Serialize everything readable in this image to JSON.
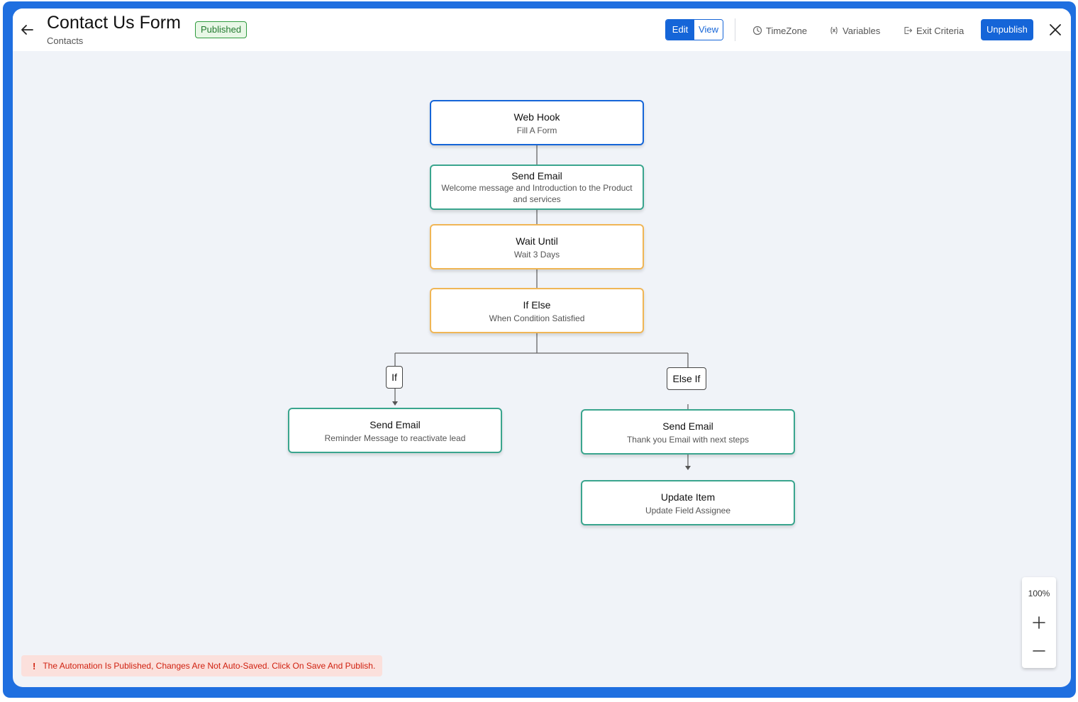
{
  "header": {
    "title": "Contact Us Form",
    "subtitle": "Contacts",
    "status_badge": "Published",
    "mode_edit": "Edit",
    "mode_view": "View",
    "timezone": "TimeZone",
    "variables": "Variables",
    "exit_criteria": "Exit Criteria",
    "unpublish": "Unpublish"
  },
  "flow": {
    "webhook": {
      "title": "Web Hook",
      "subtitle": "Fill A Form"
    },
    "send_email_welcome": {
      "title": "Send Email",
      "subtitle": "Welcome message and Introduction to the Product and services"
    },
    "wait_until": {
      "title": "Wait Until",
      "subtitle": "Wait 3 Days"
    },
    "if_else": {
      "title": "If Else",
      "subtitle": "When Condition Satisfied"
    },
    "branch_if": "If",
    "branch_else_if": "Else If",
    "send_email_reminder": {
      "title": "Send Email",
      "subtitle": "Reminder Message to reactivate lead"
    },
    "send_email_thanks": {
      "title": "Send Email",
      "subtitle": "Thank you Email with next steps"
    },
    "update_item": {
      "title": "Update Item",
      "subtitle": "Update Field Assignee"
    }
  },
  "zoom": {
    "level": "100%"
  },
  "alert": {
    "icon": "!",
    "message": "The Automation Is Published, Changes Are Not Auto-Saved. Click On Save And Publish."
  },
  "colors": {
    "accent": "#1565d8",
    "frame": "#1f6fe0",
    "email_border": "#3aa58e",
    "wait_border": "#f0b656",
    "success": "#2f9a3e",
    "error": "#d0200f"
  }
}
